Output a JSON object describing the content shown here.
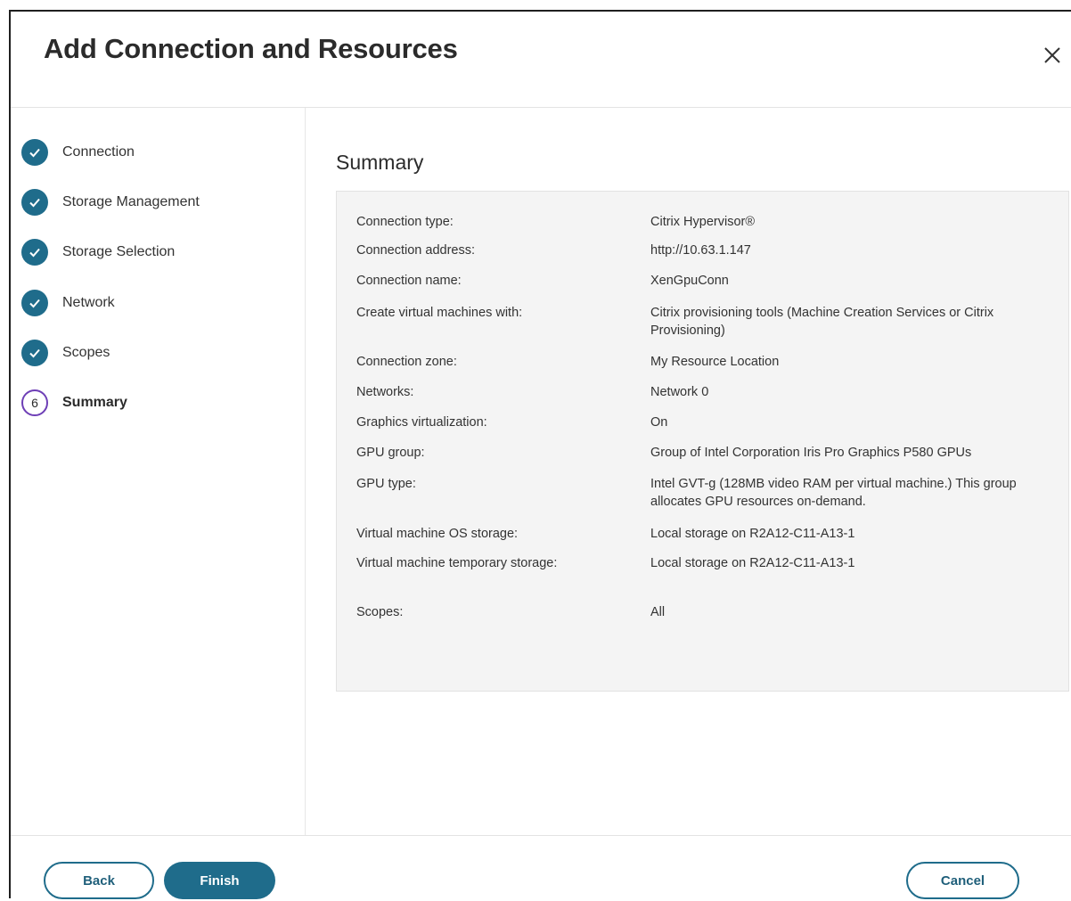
{
  "dialog": {
    "title": "Add Connection and Resources",
    "close_icon": "close-icon"
  },
  "steps": [
    {
      "label": "Connection",
      "status": "done"
    },
    {
      "label": "Storage Management",
      "status": "done"
    },
    {
      "label": "Storage Selection",
      "status": "done"
    },
    {
      "label": "Network",
      "status": "done"
    },
    {
      "label": "Scopes",
      "status": "done"
    },
    {
      "label": "Summary",
      "status": "current",
      "number": "6"
    }
  ],
  "summary": {
    "title": "Summary",
    "rows": [
      {
        "key": "Connection type:",
        "value": "Citrix Hypervisor®"
      },
      {
        "key": "Connection address:",
        "value": "http://10.63.1.147"
      },
      {
        "key": "Connection name:",
        "value": "XenGpuConn"
      },
      {
        "key": "Create virtual machines with:",
        "value": "Citrix provisioning tools (Machine Creation Services or Citrix Provisioning)"
      },
      {
        "key": "Connection zone:",
        "value": "My Resource Location"
      },
      {
        "key": "Networks:",
        "value": "Network 0"
      },
      {
        "key": "Graphics virtualization:",
        "value": "On"
      },
      {
        "key": "GPU group:",
        "value": "Group of Intel Corporation Iris Pro Graphics P580 GPUs"
      },
      {
        "key": "GPU type:",
        "value": "Intel GVT-g (128MB video RAM per virtual machine.) This group allocates GPU resources on-demand."
      },
      {
        "key": "Virtual machine OS storage:",
        "value": "Local storage on R2A12-C11-A13-1"
      },
      {
        "key": "Virtual machine temporary storage:",
        "value": "Local storage on R2A12-C11-A13-1"
      },
      {
        "key": "Scopes:",
        "value": "All"
      }
    ]
  },
  "footer": {
    "back_label": "Back",
    "finish_label": "Finish",
    "cancel_label": "Cancel"
  },
  "colors": {
    "accent": "#1f6c8b",
    "current_step_ring": "#6e3fb6",
    "summary_bg": "#f4f4f4"
  }
}
